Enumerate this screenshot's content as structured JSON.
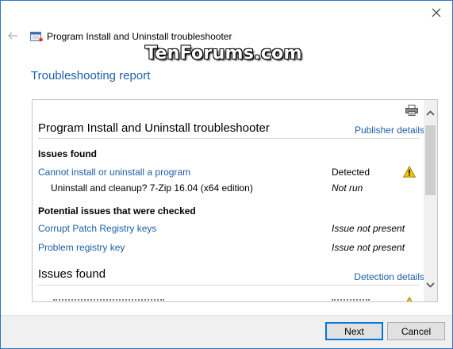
{
  "window": {
    "title": "Program Install and Uninstall troubleshooter",
    "watermark": "TenForums.com"
  },
  "page": {
    "heading": "Troubleshooting report"
  },
  "report": {
    "title": "Program Install and Uninstall troubleshooter",
    "publisher_link": "Publisher details",
    "issues_heading": "Issues found",
    "issue": {
      "name": "Cannot install or uninstall a program",
      "status": "Detected",
      "sub_item": "Uninstall and cleanup? 7-Zip 16.04 (x64 edition)",
      "sub_status": "Not run"
    },
    "potential_heading": "Potential issues that were checked",
    "checked": [
      {
        "name": "Corrupt Patch Registry keys",
        "status": "Issue not present"
      },
      {
        "name": "Problem registry key",
        "status": "Issue not present"
      }
    ],
    "section2_heading": "Issues found",
    "detection_link": "Detection details"
  },
  "footer": {
    "next_label": "Next",
    "cancel_label": "Cancel"
  },
  "colors": {
    "link": "#1c5fa8",
    "accent_border": "#0078d7",
    "warning": "#f5c400"
  }
}
